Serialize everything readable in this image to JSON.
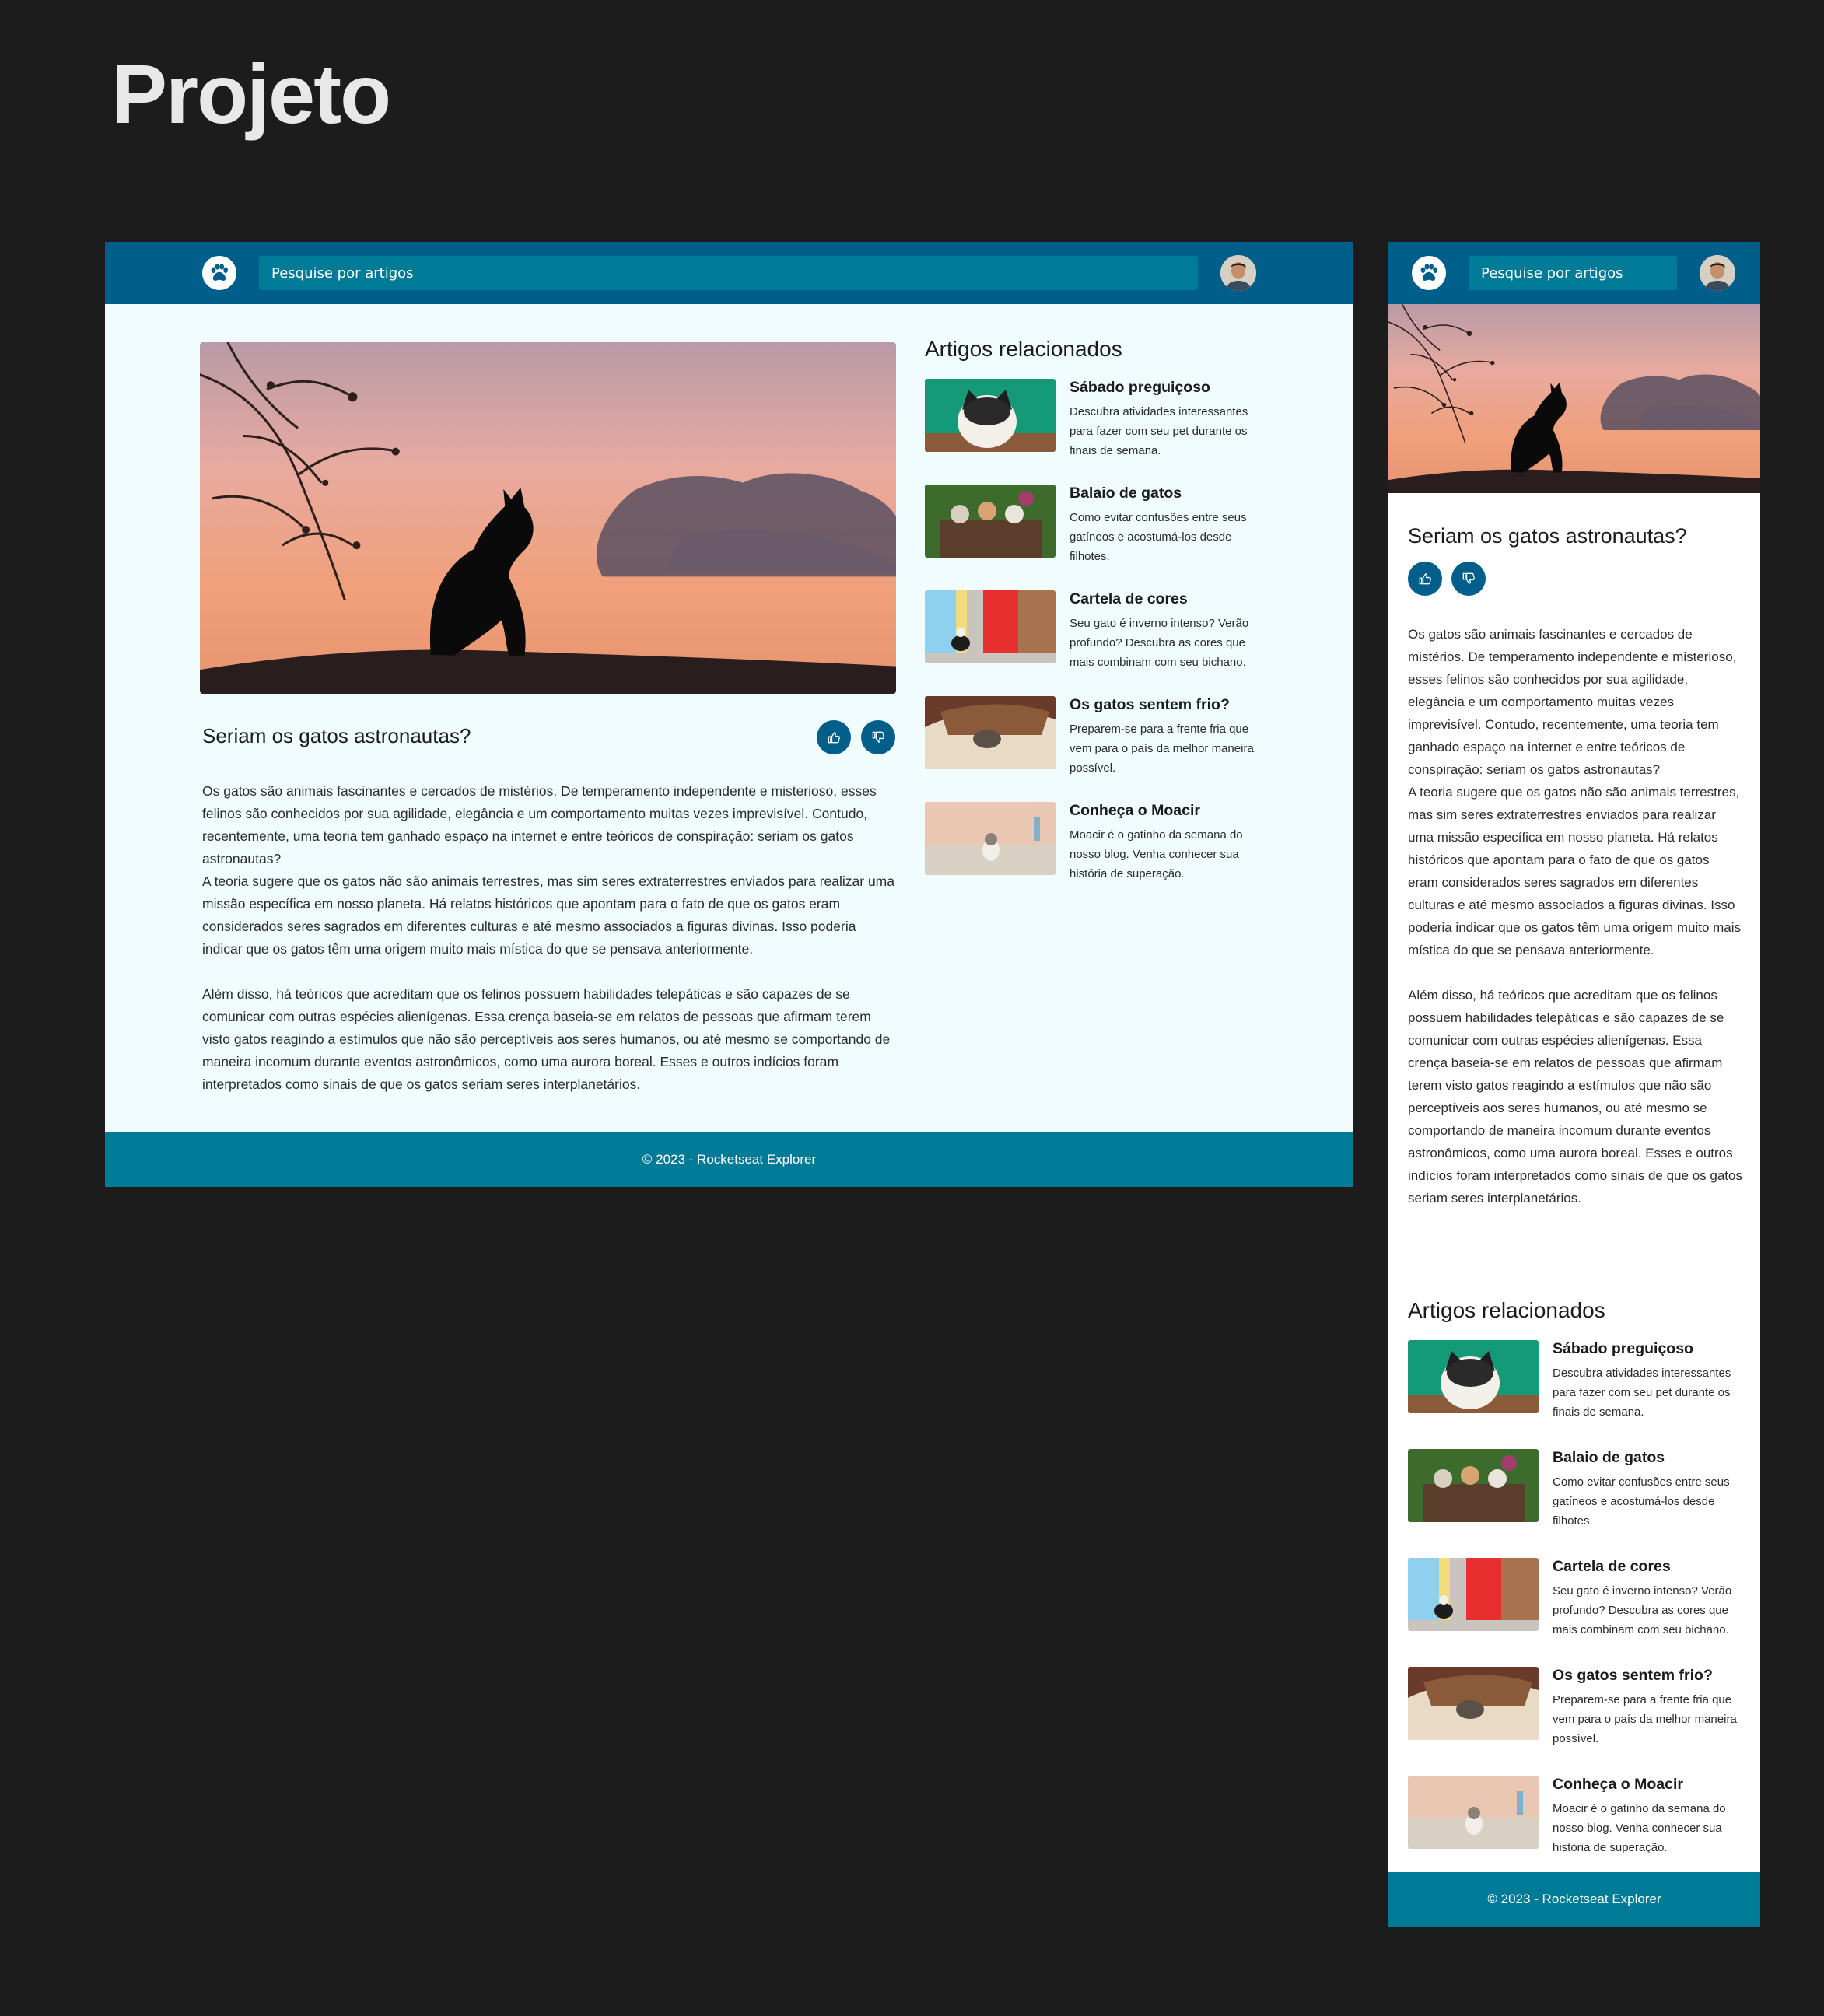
{
  "page": {
    "title": "Projeto"
  },
  "header": {
    "search_placeholder": "Pesquise por artigos"
  },
  "article": {
    "title": "Seriam os gatos astronautas?",
    "paragraphs": [
      "Os gatos são animais fascinantes e cercados de mistérios. De temperamento independente e misterioso, esses felinos são conhecidos por sua agilidade, elegância e um comportamento muitas vezes imprevisível. Contudo, recentemente, uma teoria tem ganhado espaço na internet e entre teóricos de conspiração: seriam os gatos astronautas?",
      "A teoria sugere que os gatos não são animais terrestres, mas sim seres extraterrestres enviados para realizar uma missão específica em nosso planeta. Há relatos históricos que apontam para o fato de que os gatos eram considerados seres sagrados em diferentes culturas e até mesmo associados a figuras divinas. Isso poderia indicar que os gatos têm uma origem muito mais mística do que se pensava anteriormente.",
      "Além disso, há teóricos que acreditam que os felinos possuem habilidades telepáticas e são capazes de se comunicar com outras espécies alienígenas. Essa crença baseia-se em relatos de pessoas que afirmam terem visto gatos reagindo a estímulos que não são perceptíveis aos seres humanos, ou até mesmo se comportando de maneira incomum durante eventos astronômicos, como uma aurora boreal. Esses e outros indícios foram interpretados como sinais de que os gatos seriam seres interplanetários."
    ]
  },
  "related": {
    "heading": "Artigos relacionados",
    "items": [
      {
        "title": "Sábado preguiçoso",
        "desc": "Descubra atividades interessantes para fazer com seu pet durante os finais de semana."
      },
      {
        "title": "Balaio de gatos",
        "desc": "Como evitar confusões entre seus gatíneos e acostumá-los desde filhotes."
      },
      {
        "title": "Cartela de cores",
        "desc": "Seu gato é inverno intenso? Verão profundo? Descubra as cores que mais combinam com seu bichano."
      },
      {
        "title": "Os gatos sentem frio?",
        "desc": "Preparem-se para a frente fria que vem para o país da melhor maneira possível."
      },
      {
        "title": "Conheça o Moacir",
        "desc": "Moacir é o gatinho da semana do nosso blog. Venha conhecer sua história de superação."
      }
    ]
  },
  "footer": {
    "text": "© 2023 - Rocketseat Explorer"
  },
  "colors": {
    "header": "#005f8a",
    "footer": "#007b97",
    "search": "#007b97",
    "page_bg": "#f0fcfd",
    "canvas": "#1c1c1c"
  },
  "icons": [
    "paw-icon",
    "thumbs-up-icon",
    "thumbs-down-icon"
  ]
}
